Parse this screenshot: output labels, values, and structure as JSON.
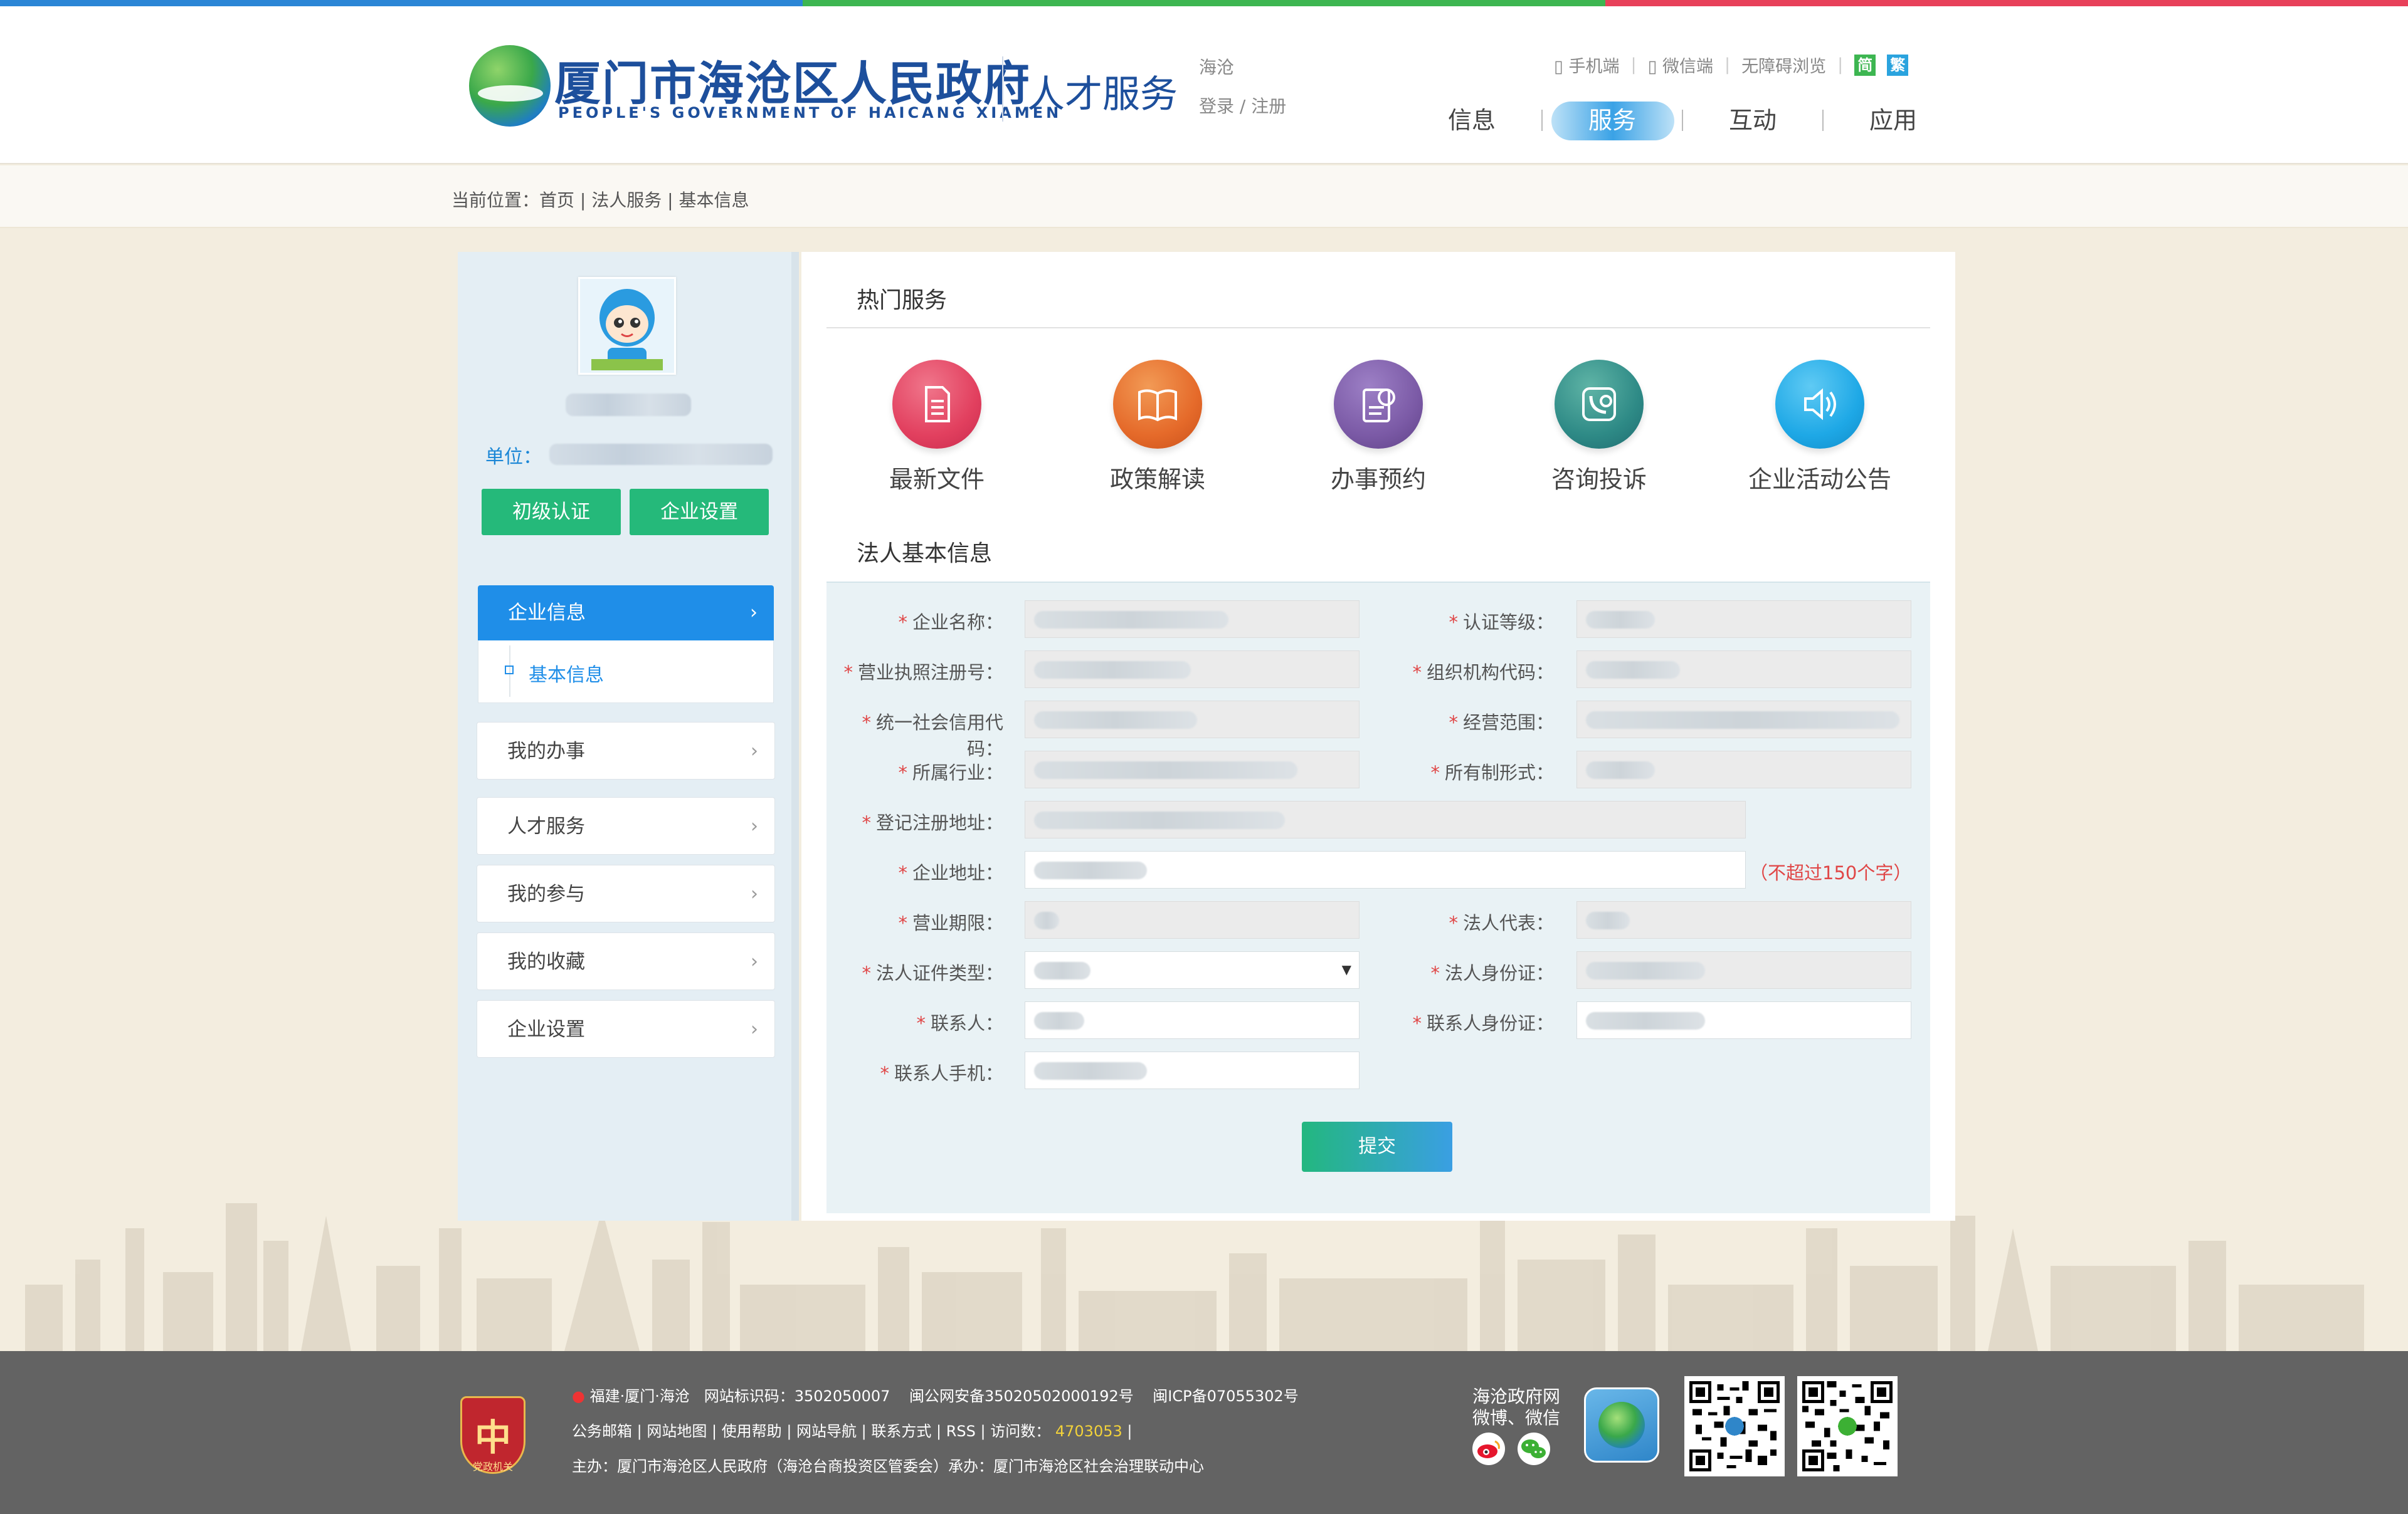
{
  "topbar_colors": [
    "#2b86d6",
    "#3db651",
    "#e8415a"
  ],
  "header": {
    "gov_title": "厦门市海沧区人民政府",
    "gov_subtitle": "PEOPLE'S GOVERNMENT OF HAICANG XIAMEN",
    "site_name": "人才服务",
    "region": "海沧",
    "login": "登录 / 注册",
    "top_links": {
      "mobile": "手机端",
      "wechat": "微信端",
      "accessible": "无障碍浏览",
      "simplified": "简",
      "traditional": "繁"
    },
    "nav": [
      "信息",
      "服务",
      "互动",
      "应用"
    ],
    "nav_active_index": 1
  },
  "breadcrumb": "当前位置：首页 | 法人服务 | 基本信息",
  "sidebar": {
    "unit_label": "单位：",
    "buttons": [
      "初级认证",
      "企业设置"
    ],
    "active_menu": "企业信息",
    "active_sub": "基本信息",
    "menu": [
      "我的办事",
      "人才服务",
      "我的参与",
      "我的收藏",
      "企业设置"
    ]
  },
  "main": {
    "hot_title": "热门服务",
    "services": [
      {
        "label": "最新文件",
        "icon": "document-icon",
        "color": "#e2405f"
      },
      {
        "label": "政策解读",
        "icon": "book-icon",
        "color": "#e56a2a"
      },
      {
        "label": "办事预约",
        "icon": "appointment-icon",
        "color": "#7b5aa6"
      },
      {
        "label": "咨询投诉",
        "icon": "phone-gear-icon",
        "color": "#2e8a86"
      },
      {
        "label": "企业活动公告",
        "icon": "speaker-icon",
        "color": "#1ea8e6"
      }
    ],
    "form_title": "法人基本信息",
    "fields": {
      "company_name": "企业名称：",
      "cert_level": "认证等级：",
      "license_no": "营业执照注册号：",
      "org_code": "组织机构代码：",
      "credit_code": "统一社会信用代码：",
      "business_scope": "经营范围：",
      "industry": "所属行业：",
      "ownership": "所有制形式：",
      "reg_address": "登记注册地址：",
      "company_address": "企业地址：",
      "address_hint": "（不超过150个字）",
      "term": "营业期限：",
      "legal_rep": "法人代表：",
      "id_type": "法人证件类型：",
      "legal_id": "法人身份证：",
      "contact": "联系人：",
      "contact_id": "联系人身份证：",
      "contact_phone": "联系人手机："
    },
    "submit": "提交"
  },
  "footer": {
    "emblem_text": "党政机关",
    "line1_region": "福建·厦门·海沧",
    "line1_site_code": "网站标识码：3502050007",
    "line1_police": "闽公网安备35020502000192号",
    "line1_icp": "闽ICP备07055302号",
    "line2_links": [
      "公务邮箱",
      "网站地图",
      "使用帮助",
      "网站导航",
      "联系方式",
      "RSS"
    ],
    "visits_label": "访问数：",
    "visits_value": "4703053",
    "line3": "主办：厦门市海沧区人民政府（海沧台商投资区管委会）承办：厦门市海沧区社会治理联动中心",
    "social_title": "海沧政府网",
    "social_subtitle": "微博、微信"
  }
}
